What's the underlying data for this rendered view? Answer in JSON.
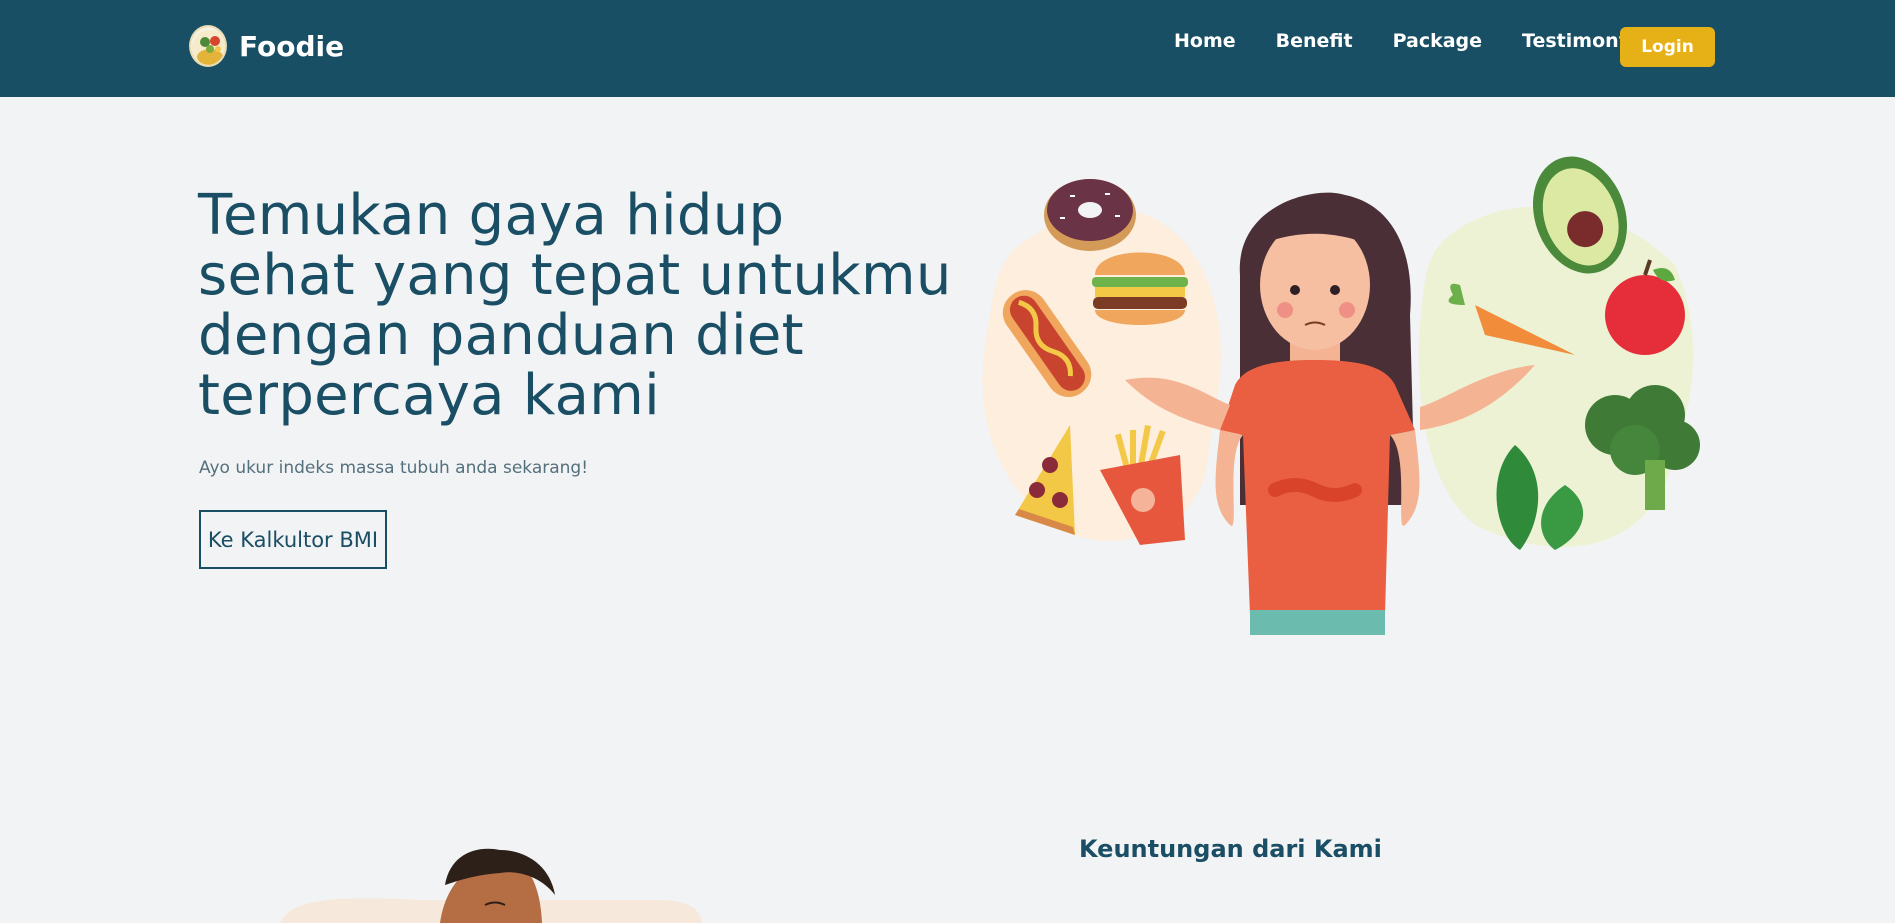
{
  "brand": {
    "name": "Foodie",
    "icon": "salad-bowl-logo"
  },
  "nav": {
    "links": [
      "Home",
      "Benefit",
      "Package",
      "Testimony"
    ],
    "login_label": "Login"
  },
  "hero": {
    "title": "Temukan gaya hidup sehat yang tepat untukmu dengan panduan diet terpercaya kami",
    "subtitle": "Ayo ukur indeks massa tubuh anda sekarang!",
    "cta_label": "Ke Kalkultor BMI"
  },
  "benefit": {
    "title": "Keuntungan dari Kami"
  },
  "colors": {
    "navbar": "#184f64",
    "accent": "#e6b017",
    "text": "#1a4e64",
    "background": "#f2f3f5"
  }
}
